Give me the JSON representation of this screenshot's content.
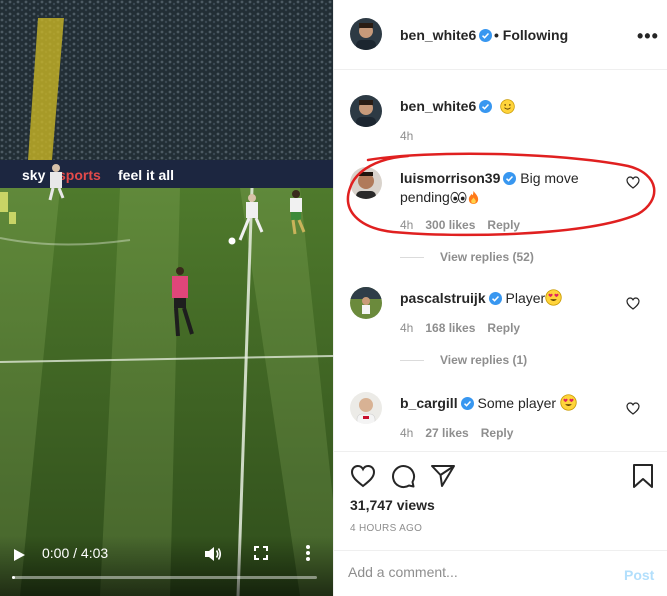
{
  "video": {
    "banner_texts": [
      "sky",
      "sports",
      "feel it all"
    ],
    "current_time": "0:00 / 4:03",
    "progress": 0.01,
    "icons": [
      "play-icon",
      "volume-icon",
      "fullscreen-icon",
      "more-vertical-icon"
    ]
  },
  "header": {
    "username": "ben_white6",
    "separator": "•",
    "follow_label": "Following",
    "more_label": "•••"
  },
  "caption": {
    "username": "ben_white6",
    "time": "4h"
  },
  "comments": [
    {
      "username": "luismorrison39",
      "text": "Big move pending",
      "time": "4h",
      "likes": "300 likes",
      "reply": "Reply",
      "view_replies": "View replies (52)"
    },
    {
      "username": "pascalstruijk",
      "text": "Player",
      "time": "4h",
      "likes": "168 likes",
      "reply": "Reply",
      "view_replies": "View replies (1)"
    },
    {
      "username": "b_cargill",
      "text": "Some player",
      "time": "4h",
      "likes": "27 likes",
      "reply": "Reply"
    }
  ],
  "footer": {
    "views": "31,747 views",
    "ago": "4 HOURS AGO",
    "placeholder": "Add a comment...",
    "post_label": "Post"
  },
  "colors": {
    "verified": "#3897f0",
    "annotation": "#e02020",
    "pitch": "#3b5e22"
  }
}
